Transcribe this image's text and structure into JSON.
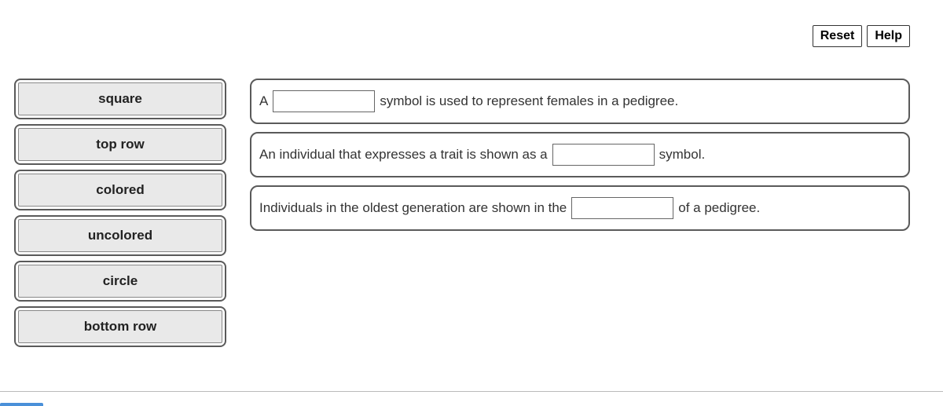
{
  "buttons": {
    "reset": "Reset",
    "help": "Help"
  },
  "wordBank": {
    "items": [
      {
        "label": "square"
      },
      {
        "label": "top row"
      },
      {
        "label": "colored"
      },
      {
        "label": "uncolored"
      },
      {
        "label": "circle"
      },
      {
        "label": "bottom row"
      }
    ]
  },
  "sentences": {
    "s1": {
      "before": "A",
      "after": "symbol is used to represent females in a pedigree."
    },
    "s2": {
      "before": "An individual that expresses a trait is shown as a",
      "after": "symbol."
    },
    "s3": {
      "before": "Individuals in the oldest generation are shown in the",
      "after": "of a pedigree."
    }
  }
}
